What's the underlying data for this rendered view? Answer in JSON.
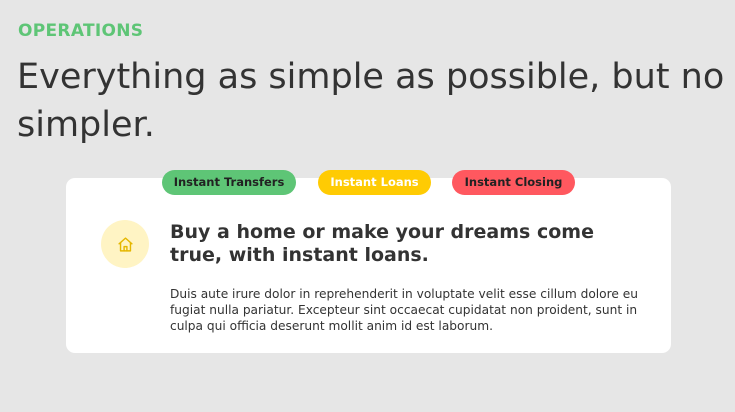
{
  "section": {
    "label": "OPERATIONS",
    "headline": "Everything as simple as possible, but no simpler."
  },
  "tabs": [
    {
      "label": "Instant Transfers",
      "color": "#5ec576"
    },
    {
      "label": "Instant Loans",
      "color": "#ffcb03"
    },
    {
      "label": "Instant Closing",
      "color": "#ff585f"
    }
  ],
  "content": {
    "icon": "home-icon",
    "title": "Buy a home or make your dreams come true, with instant loans.",
    "text": "Duis aute irure dolor in reprehenderit in voluptate velit esse cillum dolore eu fugiat nulla pariatur. Excepteur sint occaecat cupidatat non proident, sunt in culpa qui officia deserunt mollit anim id est laborum."
  },
  "colors": {
    "accent_green": "#5ec576",
    "accent_yellow": "#ffcb03",
    "accent_red": "#ff585f",
    "icon_bg": "#fff4c4",
    "icon_stroke": "#e5b700",
    "page_bg": "#e6e6e6",
    "text": "#333333"
  }
}
